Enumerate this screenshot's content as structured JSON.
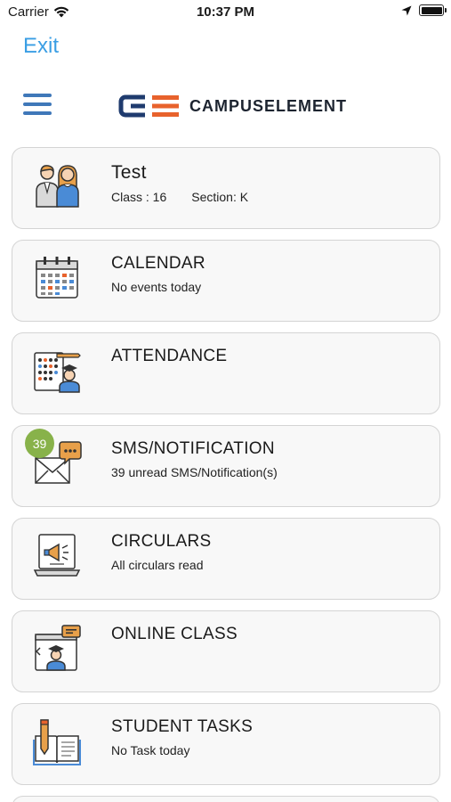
{
  "status_bar": {
    "carrier": "Carrier",
    "time": "10:37 PM"
  },
  "exit_label": "Exit",
  "brand": {
    "logo_text": "CAMPUSELEMENT",
    "colors": {
      "dark": "#1f3b6e",
      "accent": "#e8622c",
      "link": "#3a9ee4",
      "menu": "#3f78b9"
    }
  },
  "profile": {
    "name": "Test",
    "class_label": "Class : 16",
    "section_label": "Section: K",
    "icon": "students-icon"
  },
  "cards": [
    {
      "title": "CALENDAR",
      "subtitle": "No events today",
      "icon": "calendar-icon"
    },
    {
      "title": "ATTENDANCE",
      "subtitle": "",
      "icon": "attendance-icon"
    },
    {
      "title": "SMS/NOTIFICATION",
      "subtitle": "39 unread SMS/Notification(s)",
      "icon": "notification-envelope-icon",
      "badge": "39"
    },
    {
      "title": "CIRCULARS",
      "subtitle": "All circulars read",
      "icon": "circular-megaphone-icon"
    },
    {
      "title": "ONLINE CLASS",
      "subtitle": "",
      "icon": "online-class-icon"
    },
    {
      "title": "STUDENT TASKS",
      "subtitle": "No Task today",
      "icon": "tasks-book-icon"
    }
  ]
}
